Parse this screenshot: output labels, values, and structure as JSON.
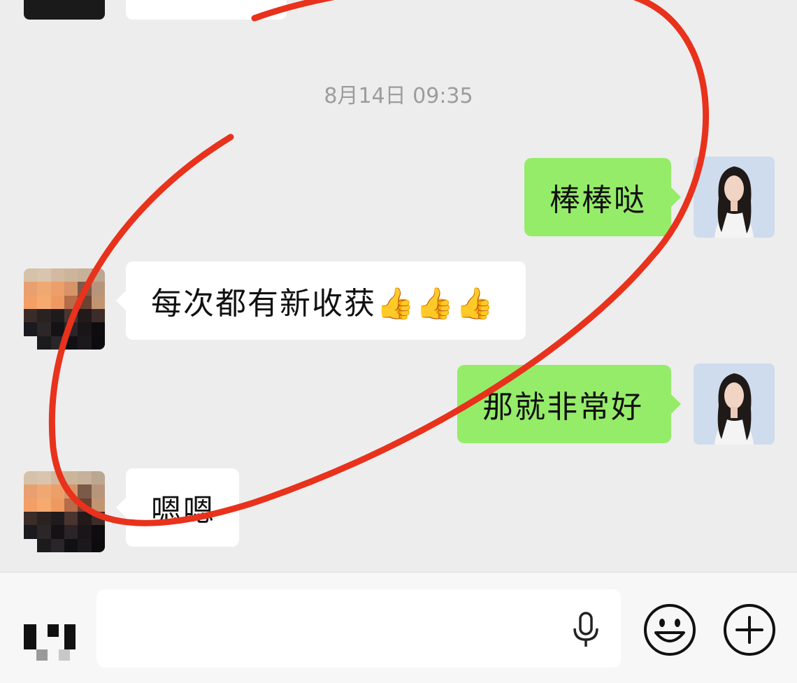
{
  "timestamp": "8月14日 09:35",
  "messages": [
    {
      "side": "right",
      "text": "棒棒哒"
    },
    {
      "side": "left",
      "text": "每次都有新收获👍👍👍"
    },
    {
      "side": "right",
      "text": "那就非常好"
    },
    {
      "side": "left",
      "text": "嗯嗯"
    }
  ],
  "input": {
    "value": ""
  },
  "icons": {
    "voice_toggle": "voice-toggle-icon",
    "mic": "microphone-icon",
    "emoji": "emoji-icon",
    "more": "plus-icon"
  },
  "colors": {
    "chat_background": "#ededed",
    "self_bubble": "#95ec69",
    "other_bubble": "#ffffff",
    "annotation_stroke": "#e8321c",
    "timestamp_text": "#9c9c9c"
  }
}
